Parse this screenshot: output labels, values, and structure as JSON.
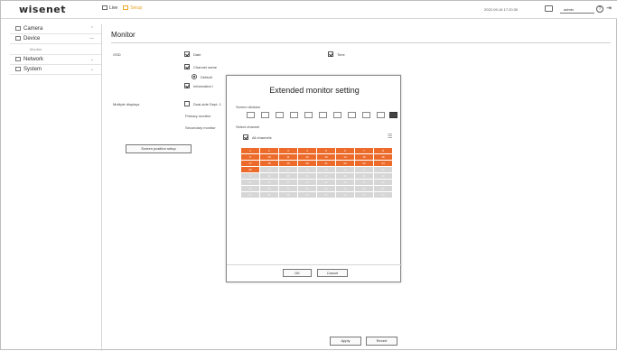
{
  "header": {
    "logo": "wisenet",
    "nav": [
      {
        "label": "Live",
        "icon": "monitor-icon"
      },
      {
        "label": "Setup",
        "icon": "gear-icon"
      }
    ],
    "datetime": "2022-09-16 17:20:30",
    "user": "admin"
  },
  "sidebar": {
    "items": [
      {
        "label": "Camera",
        "icon": "camera-icon"
      },
      {
        "label": "Device",
        "icon": "device-icon"
      },
      {
        "sub": "Monitor"
      },
      {
        "label": "Network",
        "icon": "network-icon"
      },
      {
        "label": "System",
        "icon": "system-icon"
      }
    ]
  },
  "main": {
    "title": "Monitor",
    "osd_label": "OSD",
    "date_label": "Date",
    "time_label": "Time",
    "channel_name_label": "Channel name",
    "default_label": "Default",
    "information_label": "Information i",
    "multiple_displays_label": "Multiple displays",
    "dual_label": "Dual-side Dept. 1",
    "primary_label": "Primary monitor",
    "secondary_label": "Secondary monitor",
    "screen_position_button": "Screen position setup",
    "apply_button": "Apply",
    "revert_button": "Revert"
  },
  "modal": {
    "title": "Extended monitor setting",
    "screen_division_label": "Screen division",
    "select_channel_label": "Select channel",
    "all_channels_label": "All channels",
    "ok_button": "OK",
    "cancel_button": "Cancel",
    "channels_selected": [
      "1",
      "2",
      "3",
      "4",
      "5",
      "6",
      "7",
      "8",
      "9",
      "10",
      "11",
      "12",
      "13",
      "14",
      "15",
      "16",
      "17",
      "18",
      "19",
      "20",
      "21",
      "22",
      "23",
      "24",
      "25"
    ],
    "channels_unselected": [
      "26",
      "27",
      "28",
      "29",
      "30",
      "31",
      "32",
      "33",
      "34",
      "35",
      "36",
      "37",
      "38",
      "39",
      "40",
      "41",
      "42",
      "43",
      "44",
      "45",
      "46",
      "47",
      "48",
      "49",
      "50",
      "51",
      "52",
      "53",
      "54",
      "55",
      "56",
      "57",
      "58",
      "59",
      "60",
      "61",
      "62",
      "63",
      "64"
    ]
  },
  "colors": {
    "selected_channel": "#ed6b2a",
    "unselected_channel": "#d6d6d6",
    "setup_accent": "#e9a62a"
  }
}
